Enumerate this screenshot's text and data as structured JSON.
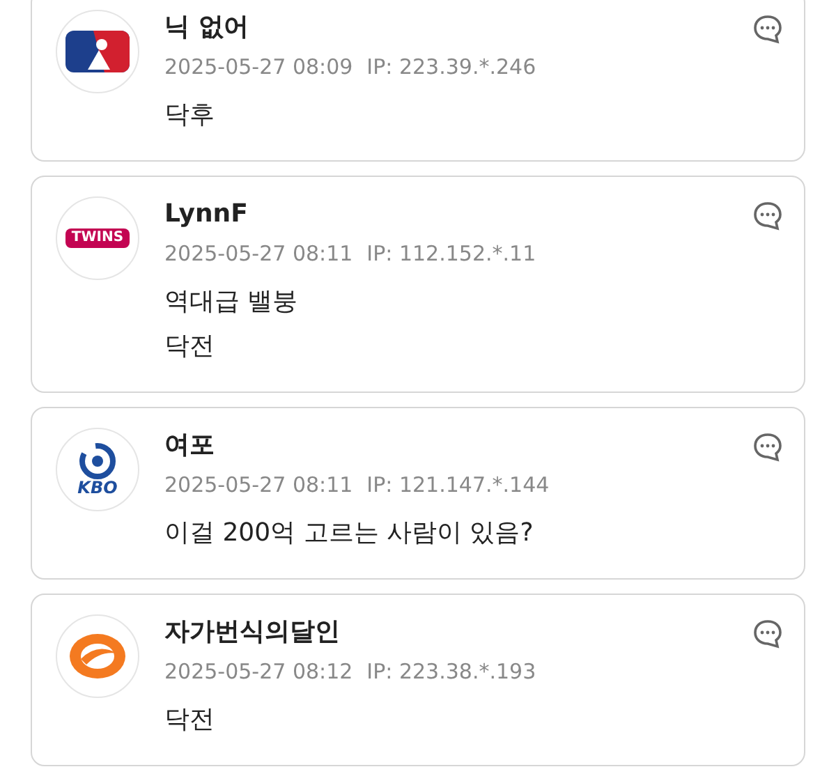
{
  "comments": [
    {
      "avatar": {
        "kind": "shield"
      },
      "name": "닉 없어",
      "date": "2025-05-27 08:09",
      "ip": "IP: 223.39.*.246",
      "lines": [
        "닥후"
      ]
    },
    {
      "avatar": {
        "kind": "badge",
        "logo_text": "TWINS"
      },
      "name": "LynnF",
      "date": "2025-05-27 08:11",
      "ip": "IP: 112.152.*.11",
      "lines": [
        "역대급 밸붕",
        "닥전"
      ]
    },
    {
      "avatar": {
        "kind": "swirl",
        "logo_text": "KBO"
      },
      "name": "여포",
      "date": "2025-05-27 08:11",
      "ip": "IP: 121.147.*.144",
      "lines": [
        "이걸 200억 고르는 사람이 있음?"
      ]
    },
    {
      "avatar": {
        "kind": "flame"
      },
      "name": "자가번식의달인",
      "date": "2025-05-27 08:12",
      "ip": "IP: 223.38.*.193",
      "lines": [
        "닥전"
      ]
    }
  ]
}
